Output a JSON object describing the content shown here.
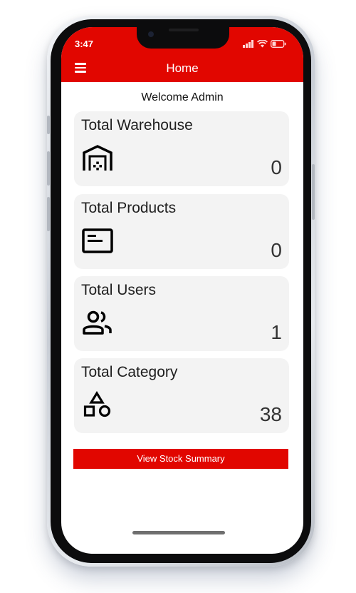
{
  "status_bar": {
    "time": "3:47",
    "icons": [
      "signal-icon",
      "wifi-icon",
      "battery-icon"
    ]
  },
  "header": {
    "title": "Home",
    "menu_icon": "hamburger-menu-icon"
  },
  "welcome_text": "Welcome Admin",
  "cards": [
    {
      "title": "Total Warehouse",
      "value": "0",
      "icon": "warehouse-icon"
    },
    {
      "title": "Total Products",
      "value": "0",
      "icon": "product-card-icon"
    },
    {
      "title": "Total Users",
      "value": "1",
      "icon": "users-icon"
    },
    {
      "title": "Total Category",
      "value": "38",
      "icon": "category-shapes-icon"
    }
  ],
  "stock_button_label": "View Stock Summary",
  "colors": {
    "brand_red": "#e10600",
    "card_bg": "#f3f3f3",
    "text": "#1f1f1f"
  }
}
